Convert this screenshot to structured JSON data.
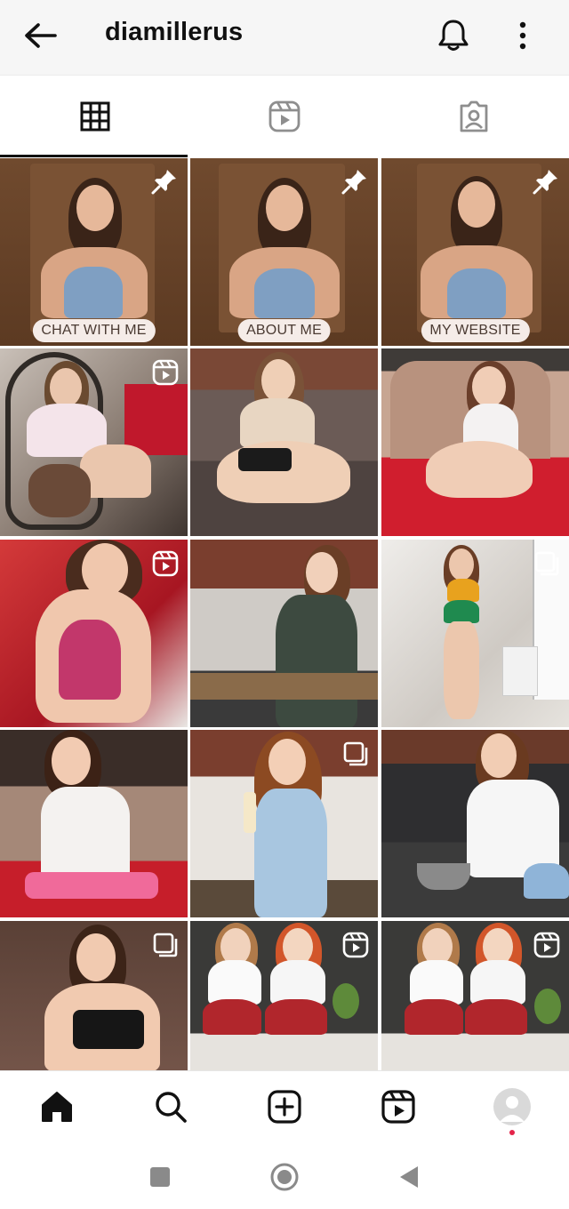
{
  "header": {
    "username": "diamillerus",
    "back_icon": "arrow-left-icon",
    "bell_icon": "bell-icon",
    "more_icon": "more-vertical-icon"
  },
  "tabs": [
    {
      "name": "grid",
      "icon": "grid-icon",
      "active": true
    },
    {
      "name": "reels",
      "icon": "reels-icon",
      "active": false
    },
    {
      "name": "tagged",
      "icon": "tagged-icon",
      "active": false
    }
  ],
  "highlights": [
    {
      "label": "CHAT WITH ME"
    },
    {
      "label": "ABOUT ME"
    },
    {
      "label": "MY WEBSITE"
    }
  ],
  "posts": [
    {
      "kind": "pinned",
      "icon": "pin-icon"
    },
    {
      "kind": "pinned",
      "icon": "pin-icon"
    },
    {
      "kind": "pinned",
      "icon": "pin-icon"
    },
    {
      "kind": "reel",
      "icon": "reel-badge-icon"
    },
    {
      "kind": "photo",
      "icon": ""
    },
    {
      "kind": "photo",
      "icon": ""
    },
    {
      "kind": "reel",
      "icon": "reel-badge-icon"
    },
    {
      "kind": "photo",
      "icon": ""
    },
    {
      "kind": "carousel",
      "icon": "carousel-icon"
    },
    {
      "kind": "photo",
      "icon": ""
    },
    {
      "kind": "carousel",
      "icon": "carousel-icon"
    },
    {
      "kind": "photo",
      "icon": ""
    },
    {
      "kind": "carousel",
      "icon": "carousel-icon"
    },
    {
      "kind": "reel",
      "icon": "reel-badge-icon"
    },
    {
      "kind": "reel",
      "icon": "reel-badge-icon"
    }
  ],
  "bottom_nav": [
    {
      "name": "home",
      "icon": "home-icon",
      "active": true
    },
    {
      "name": "search",
      "icon": "search-icon"
    },
    {
      "name": "create",
      "icon": "add-post-icon"
    },
    {
      "name": "reels",
      "icon": "reels-icon"
    },
    {
      "name": "profile",
      "icon": "profile-avatar-icon"
    }
  ],
  "system_nav": [
    {
      "name": "recents",
      "icon": "square-icon"
    },
    {
      "name": "home",
      "icon": "circle-icon"
    },
    {
      "name": "back",
      "icon": "triangle-back-icon"
    }
  ],
  "colors": {
    "highlight_bg": "#6e4a30",
    "chip_bg": "#f5ece8",
    "accent_red": "#e4244a",
    "text": "#111111"
  }
}
